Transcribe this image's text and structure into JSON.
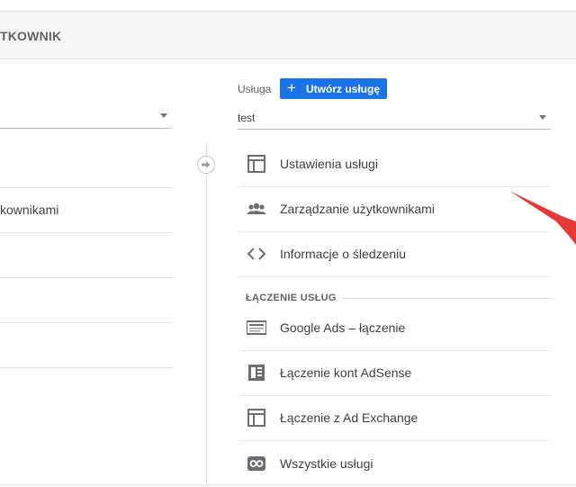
{
  "header": {
    "title_cut": "TKOWNIK"
  },
  "left": {
    "items": [
      {
        "label": ""
      },
      {
        "label": "kownikami"
      },
      {
        "label": ""
      },
      {
        "label": ""
      },
      {
        "label": ""
      }
    ]
  },
  "right": {
    "service_label": "Usługa",
    "create_button": "Utwórz usługę",
    "service_value": "test",
    "items": [
      {
        "label": "Ustawienia usługi",
        "icon": "layout-icon"
      },
      {
        "label": "Zarządzanie użytkownikami",
        "icon": "people-icon"
      },
      {
        "label": "Informacje o śledzeniu",
        "icon": "code-icon"
      }
    ],
    "section_title": "ŁĄCZENIE USŁUG",
    "link_items": [
      {
        "label": "Google Ads – łączenie",
        "icon": "ads-icon"
      },
      {
        "label": "Łączenie kont AdSense",
        "icon": "adsense-icon"
      },
      {
        "label": "Łączenie z Ad Exchange",
        "icon": "adexchange-icon"
      },
      {
        "label": "Wszystkie usługi",
        "icon": "all-products-icon"
      }
    ]
  },
  "colors": {
    "accent": "#1a73e8",
    "annotation_arrow": "#e53935"
  }
}
